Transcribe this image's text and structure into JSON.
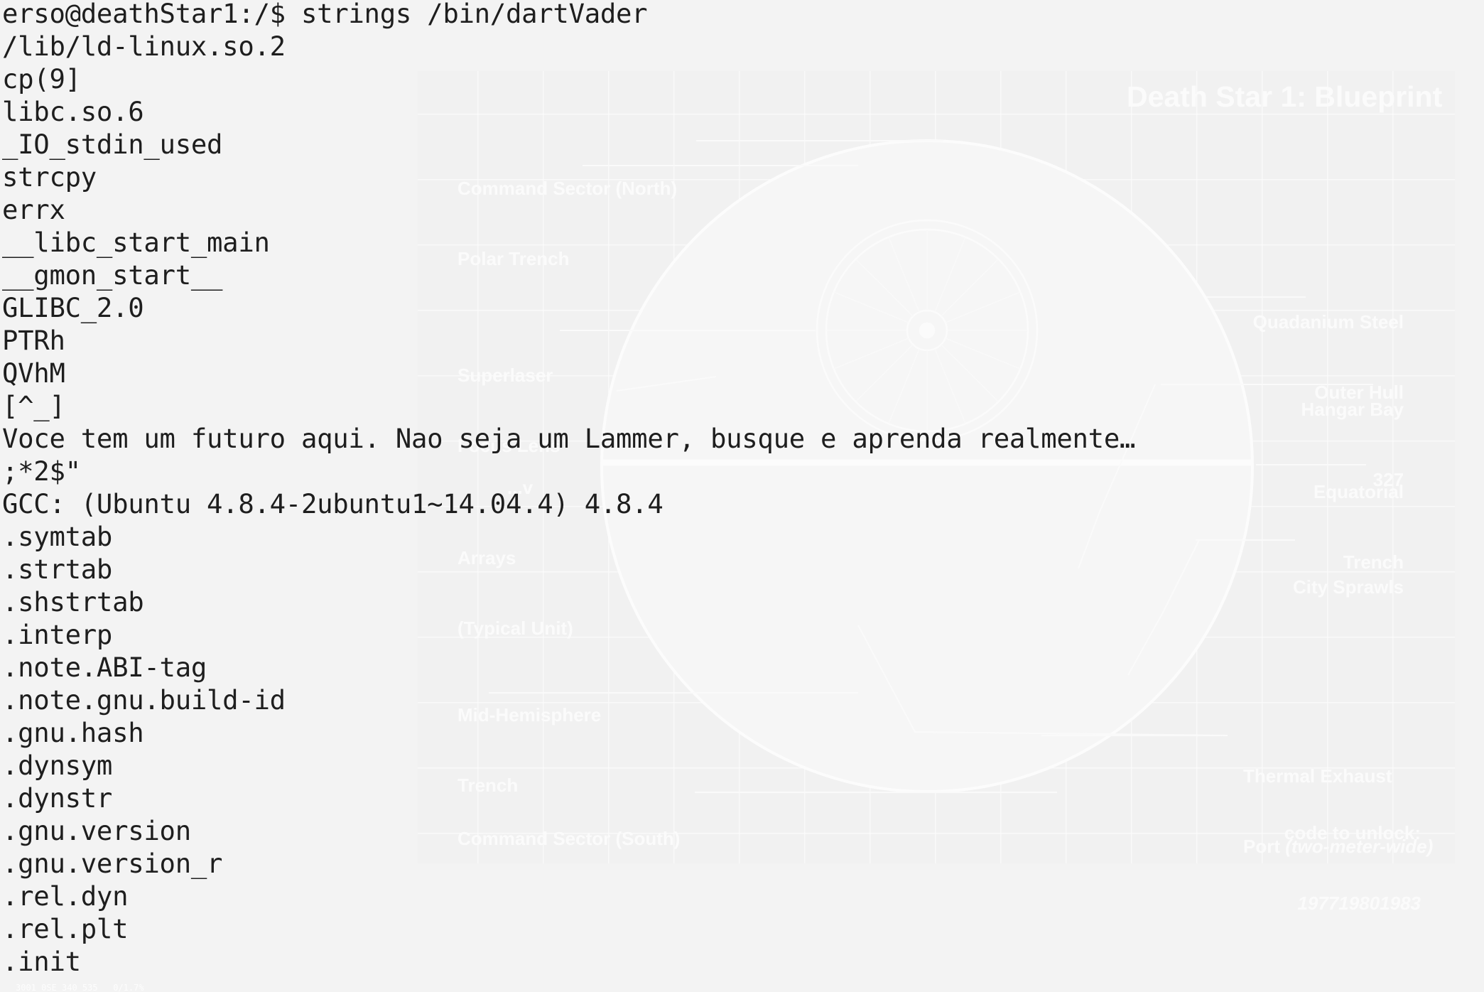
{
  "terminal": {
    "lines": [
      "erso@deathStar1:/$ strings /bin/dartVader",
      "/lib/ld-linux.so.2",
      "cp(9]",
      "libc.so.6",
      "_IO_stdin_used",
      "strcpy",
      "errx",
      "__libc_start_main",
      "__gmon_start__",
      "GLIBC_2.0",
      "PTRh",
      "QVhM",
      "[^_]",
      "Voce tem um futuro aqui. Nao seja um Lammer, busque e aprenda realmente…",
      ";*2$\"",
      "GCC: (Ubuntu 4.8.4-2ubuntu1~14.04.4) 4.8.4",
      ".symtab",
      ".strtab",
      ".shstrtab",
      ".interp",
      ".note.ABI-tag",
      ".note.gnu.build-id",
      ".gnu.hash",
      ".dynsym",
      ".dynstr",
      ".gnu.version",
      ".gnu.version_r",
      ".rel.dyn",
      ".rel.plt",
      ".init"
    ]
  },
  "blueprint": {
    "title": "Death Star 1: Blueprint",
    "labels": {
      "command_north_1": "Command Sector (North)",
      "command_north_2": "Polar Trench",
      "superlaser_1": "Superlaser",
      "superlaser_2": "Focus Lens",
      "arrays_0": "...v",
      "arrays_1": "Arrays",
      "arrays_2": "(Typical Unit)",
      "mid_trench_1": "Mid-Hemisphere",
      "mid_trench_2": "Trench",
      "command_south": "Command Sector (South)",
      "hull_1": "Quadanium Steel",
      "hull_2": "Outer Hull",
      "hangar_1": "Hangar Bay",
      "hangar_2": "327",
      "equatorial_1": "Equatorial",
      "equatorial_2": "Trench",
      "city": "City Sprawls",
      "exhaust_1": "Thermal Exhaust",
      "exhaust_2": "Port",
      "exhaust_3": "(two-meter-wide)",
      "unlock_label": "code to unlock:",
      "unlock_value": "197719801983"
    }
  },
  "status_strip": "3001 0SE 340 535   0/1.7%",
  "colors": {
    "background": "#f3f3f3",
    "terminal_text": "#1e1e1e",
    "watermark": "#fbfbfb"
  }
}
